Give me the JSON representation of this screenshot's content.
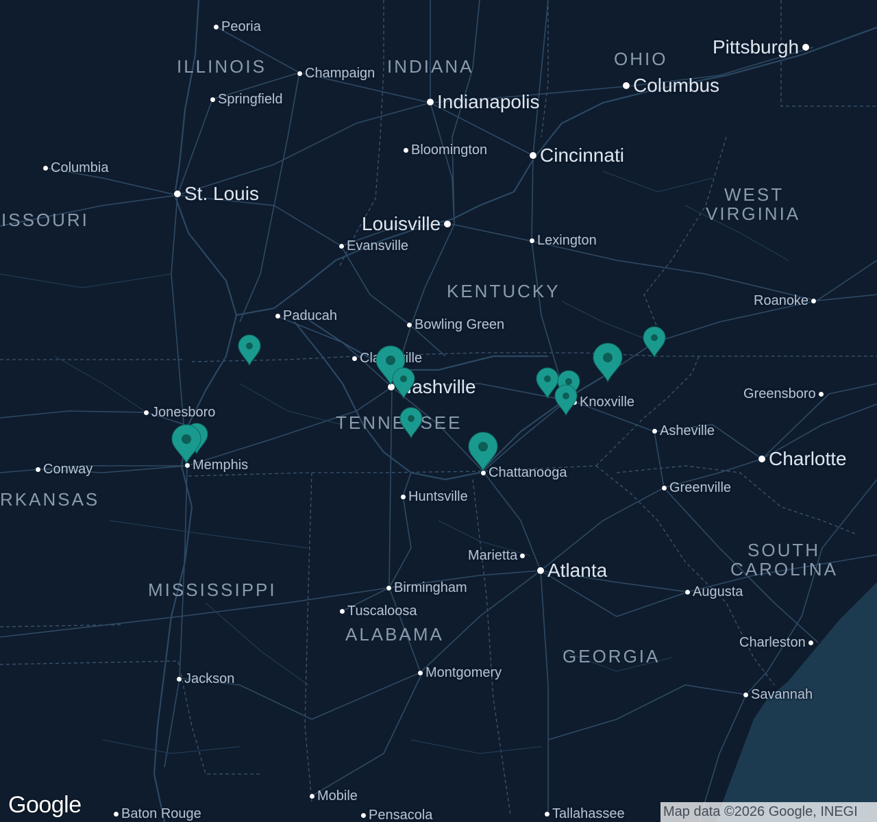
{
  "map": {
    "provider_logo": "Google",
    "attribution": "Map data ©2026 Google, INEGI",
    "colors": {
      "land": "#0f1c2e",
      "water": "#1d3b50",
      "roads": "#2e4a63",
      "borders": "#3b5670",
      "marker": "#1a9a8e",
      "marker_dot": "#0c5e56"
    }
  },
  "states": [
    {
      "name": "ILLINOIS"
    },
    {
      "name": "INDIANA"
    },
    {
      "name": "OHIO"
    },
    {
      "name": "WEST"
    },
    {
      "name": "VIRGINIA"
    },
    {
      "name": "ISSOURI"
    },
    {
      "name": "KENTUCKY"
    },
    {
      "name": "TENNESSEE"
    },
    {
      "name": "RKANSAS"
    },
    {
      "name": "MISSISSIPPI"
    },
    {
      "name": "ALABAMA"
    },
    {
      "name": "GEORGIA"
    },
    {
      "name": "SOUTH"
    },
    {
      "name": "CAROLINA"
    }
  ],
  "cities": [
    {
      "name": "Peoria"
    },
    {
      "name": "Champaign"
    },
    {
      "name": "Springfield"
    },
    {
      "name": "Indianapolis"
    },
    {
      "name": "Columbus"
    },
    {
      "name": "Pittsburgh"
    },
    {
      "name": "Bloomington"
    },
    {
      "name": "Cincinnati"
    },
    {
      "name": "Columbia"
    },
    {
      "name": "St. Louis"
    },
    {
      "name": "Louisville"
    },
    {
      "name": "Evansville"
    },
    {
      "name": "Lexington"
    },
    {
      "name": "Paducah"
    },
    {
      "name": "Bowling Green"
    },
    {
      "name": "Roanoke"
    },
    {
      "name": "Clarksville"
    },
    {
      "name": "Nashville"
    },
    {
      "name": "Knoxville"
    },
    {
      "name": "Greensboro"
    },
    {
      "name": "Jonesboro"
    },
    {
      "name": "Asheville"
    },
    {
      "name": "Charlotte"
    },
    {
      "name": "Memphis"
    },
    {
      "name": "Chattanooga"
    },
    {
      "name": "Conway"
    },
    {
      "name": "Greenville"
    },
    {
      "name": "Huntsville"
    },
    {
      "name": "Marietta"
    },
    {
      "name": "Atlanta"
    },
    {
      "name": "Birmingham"
    },
    {
      "name": "Augusta"
    },
    {
      "name": "Tuscaloosa"
    },
    {
      "name": "Charleston"
    },
    {
      "name": "Jackson"
    },
    {
      "name": "Montgomery"
    },
    {
      "name": "Savannah"
    },
    {
      "name": "Mobile"
    },
    {
      "name": "Baton Rouge"
    },
    {
      "name": "Pensacola"
    },
    {
      "name": "Tallahassee"
    }
  ],
  "markers": [
    {
      "id": "marker-1",
      "near": "Paducah"
    },
    {
      "id": "marker-2",
      "near": "Memphis"
    },
    {
      "id": "marker-3",
      "near": "Memphis"
    },
    {
      "id": "marker-4",
      "near": "Clarksville"
    },
    {
      "id": "marker-5",
      "near": "Nashville"
    },
    {
      "id": "marker-6",
      "near": "Nashville"
    },
    {
      "id": "marker-7",
      "near": "Chattanooga"
    },
    {
      "id": "marker-8",
      "near": "Knoxville"
    },
    {
      "id": "marker-9",
      "near": "Knoxville"
    },
    {
      "id": "marker-10",
      "near": "Knoxville"
    },
    {
      "id": "marker-11",
      "near": "Knoxville"
    },
    {
      "id": "marker-12",
      "near": "Knoxville"
    }
  ]
}
